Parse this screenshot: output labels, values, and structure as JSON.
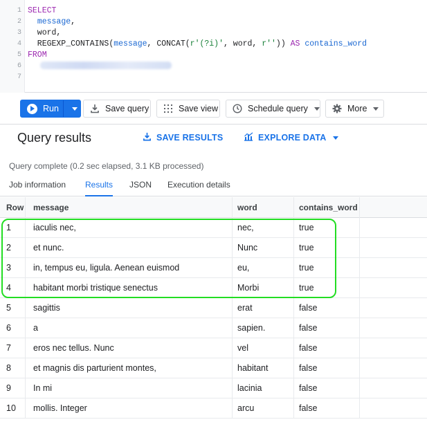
{
  "editor": {
    "lines": [
      {
        "n": "1",
        "parts": [
          {
            "t": "SELECT",
            "c": "kw"
          }
        ]
      },
      {
        "n": "2",
        "parts": [
          {
            "t": "  "
          },
          {
            "t": "message",
            "c": "col"
          },
          {
            "t": ","
          }
        ]
      },
      {
        "n": "3",
        "parts": [
          {
            "t": "  word,"
          }
        ]
      },
      {
        "n": "4",
        "parts": [
          {
            "t": "  REGEXP_CONTAINS("
          },
          {
            "t": "message",
            "c": "col"
          },
          {
            "t": ", CONCAT("
          },
          {
            "t": "r'(?i)'",
            "c": "str"
          },
          {
            "t": ", word, "
          },
          {
            "t": "r''",
            "c": "str"
          },
          {
            "t": ")) "
          },
          {
            "t": "AS",
            "c": "kw"
          },
          {
            "t": " "
          },
          {
            "t": "contains_word",
            "c": "col"
          }
        ]
      },
      {
        "n": "5",
        "parts": [
          {
            "t": "FROM",
            "c": "kw"
          }
        ]
      },
      {
        "n": "6",
        "parts": [
          {
            "t": "",
            "c": "blur"
          }
        ]
      },
      {
        "n": "7",
        "parts": []
      }
    ]
  },
  "toolbar": {
    "run_label": "Run",
    "save_query_label": "Save query",
    "save_view_label": "Save view",
    "schedule_query_label": "Schedule query",
    "more_label": "More"
  },
  "results": {
    "title": "Query results",
    "save_results_label": "SAVE RESULTS",
    "explore_data_label": "EXPLORE DATA",
    "status": "Query complete (0.2 sec elapsed, 3.1 KB processed)",
    "tabs": [
      "Job information",
      "Results",
      "JSON",
      "Execution details"
    ],
    "active_tab": "Results"
  },
  "table": {
    "columns": [
      "Row",
      "message",
      "word",
      "contains_word"
    ],
    "rows": [
      [
        "1",
        "iaculis nec,",
        "nec,",
        "true"
      ],
      [
        "2",
        "et nunc.",
        "Nunc",
        "true"
      ],
      [
        "3",
        "in, tempus eu, ligula. Aenean euismod",
        "eu,",
        "true"
      ],
      [
        "4",
        "habitant morbi tristique senectus",
        "Morbi",
        "true"
      ],
      [
        "5",
        "sagittis",
        "erat",
        "false"
      ],
      [
        "6",
        "a",
        "sapien.",
        "false"
      ],
      [
        "7",
        "eros nec tellus. Nunc",
        "vel",
        "false"
      ],
      [
        "8",
        "et magnis dis parturient montes,",
        "habitant",
        "false"
      ],
      [
        "9",
        "In mi",
        "lacinia",
        "false"
      ],
      [
        "10",
        "mollis. Integer",
        "arcu",
        "false"
      ]
    ]
  },
  "colors": {
    "accent": "#1a73e8",
    "highlight": "#22dd22"
  }
}
